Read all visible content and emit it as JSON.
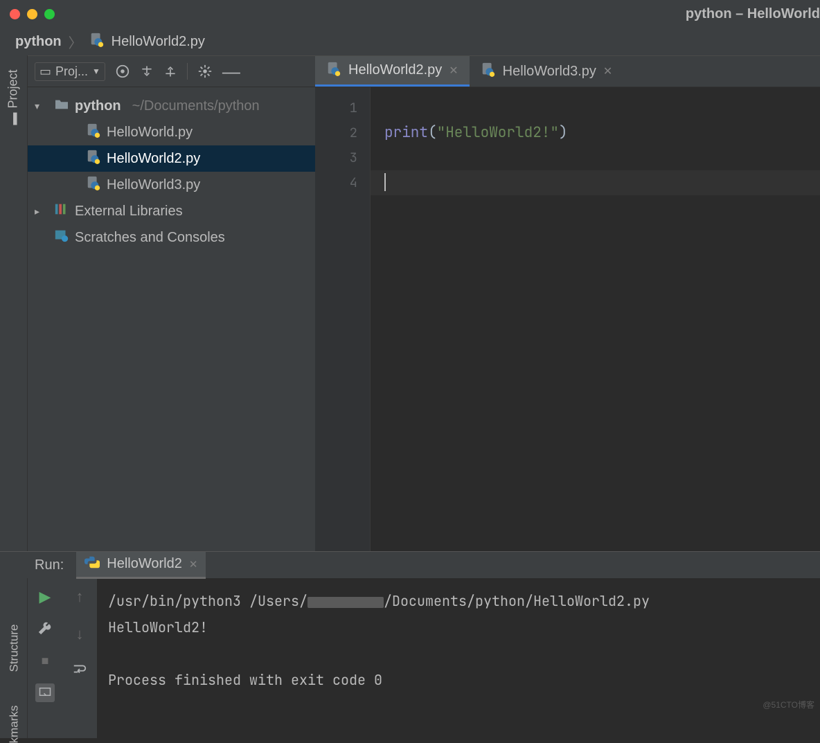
{
  "window": {
    "title": "python – HelloWorld"
  },
  "breadcrumb": {
    "root": "python",
    "file": "HelloWorld2.py"
  },
  "panel": {
    "title": "Proj...",
    "project_name": "python",
    "project_path": "~/Documents/python",
    "files": [
      "HelloWorld.py",
      "HelloWorld2.py",
      "HelloWorld3.py"
    ],
    "selected": "HelloWorld2.py",
    "external": "External Libraries",
    "scratches": "Scratches and Consoles"
  },
  "rail": {
    "project": "Project",
    "structure": "Structure",
    "bookmarks": "kmarks"
  },
  "tabs": [
    {
      "label": "HelloWorld2.py",
      "active": true
    },
    {
      "label": "HelloWorld3.py",
      "active": false
    }
  ],
  "editor": {
    "line_numbers": [
      "1",
      "2",
      "3",
      "4"
    ],
    "code": {
      "fn": "print",
      "lpar": "(",
      "str": "\"HelloWorld2!\"",
      "rpar": ")"
    }
  },
  "run": {
    "label": "Run:",
    "tab": "HelloWorld2",
    "cmd_pre": "/usr/bin/python3  /Users/",
    "cmd_post": "/Documents/python/HelloWorld2.py",
    "output": "HelloWorld2!",
    "exit": "Process finished with exit code 0"
  },
  "watermark": "@51CTO博客"
}
